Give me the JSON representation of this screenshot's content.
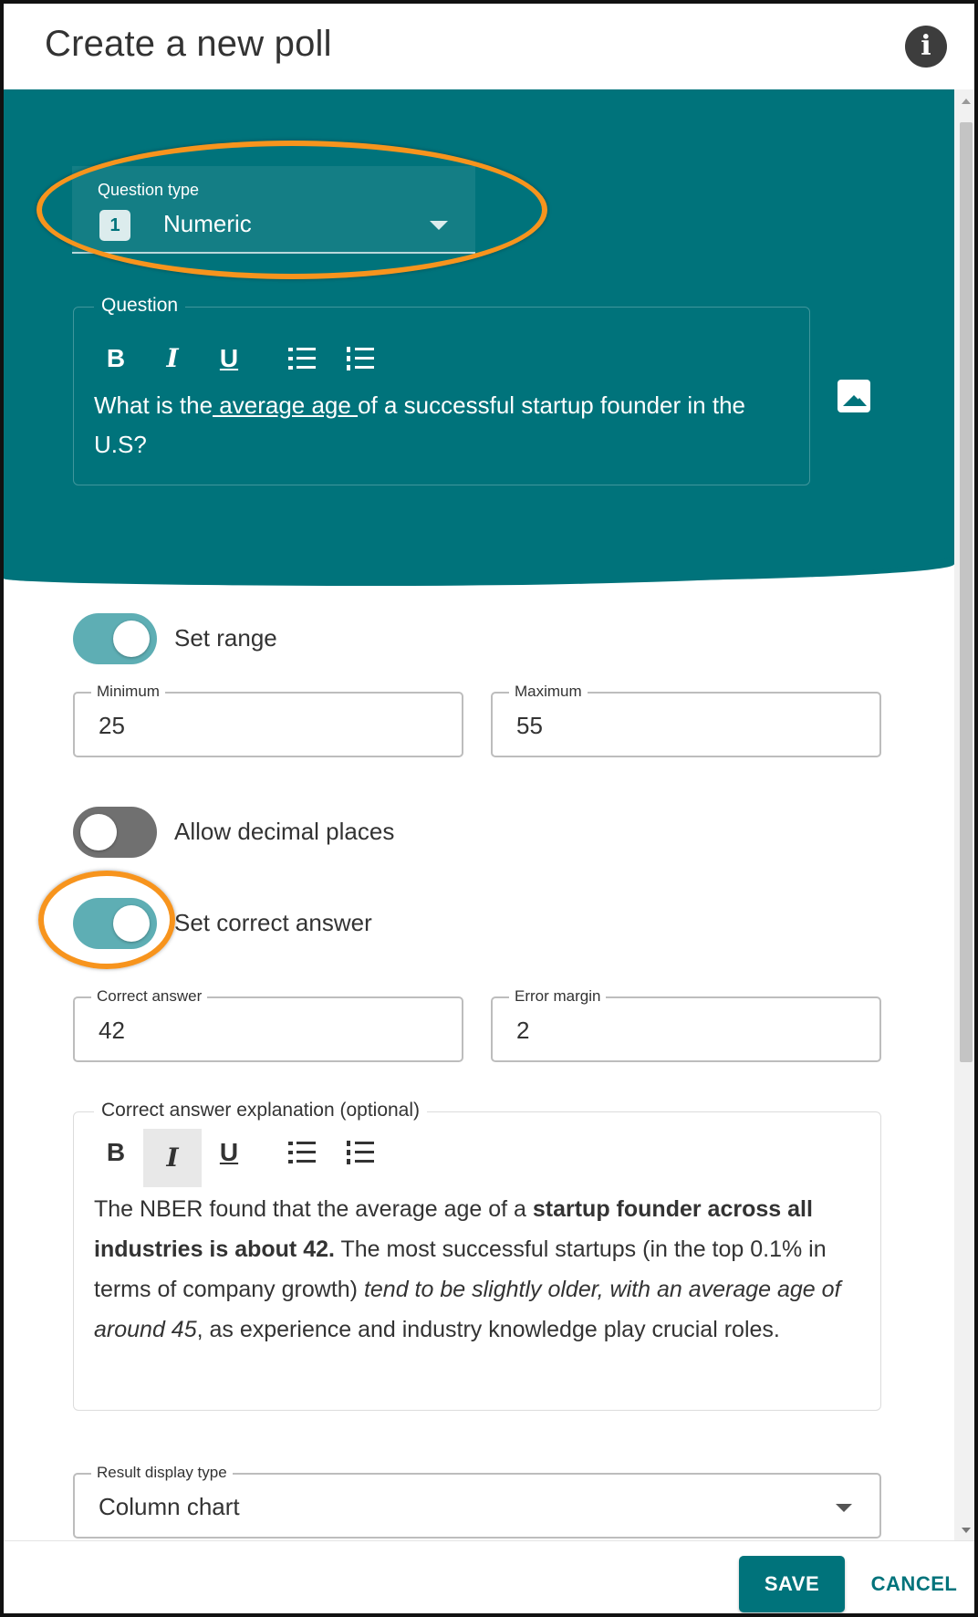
{
  "dialog": {
    "title": "Create a new poll"
  },
  "question_type": {
    "label": "Question type",
    "badge": "1",
    "value": "Numeric"
  },
  "question": {
    "legend": "Question",
    "text_before": "What is the",
    "text_underlined": " average age ",
    "text_after": "of a successful startup founder in the U.S?"
  },
  "toolbar": {
    "bold": "B",
    "italic": "I",
    "underline": "U"
  },
  "set_range": {
    "label": "Set range",
    "on": true
  },
  "range": {
    "min_label": "Minimum",
    "min_value": "25",
    "max_label": "Maximum",
    "max_value": "55"
  },
  "decimal": {
    "label": "Allow decimal places",
    "on": false
  },
  "correct_toggle": {
    "label": "Set correct answer",
    "on": true
  },
  "answer": {
    "correct_label": "Correct answer",
    "correct_value": "42",
    "margin_label": "Error margin",
    "margin_value": "2"
  },
  "explanation": {
    "legend": "Correct answer explanation (optional)",
    "t1": "The NBER found that the average age of a ",
    "t2_bold": "startup founder across all industries is about 42.",
    "t3": " The most successful startups (in the top 0.1% in terms of company growth) ",
    "t4_italic": "tend to be slightly older, with an average age of around 45",
    "t5": ", as experience and industry knowledge play crucial roles."
  },
  "result_display": {
    "label": "Result display type",
    "value": "Column chart"
  },
  "footer": {
    "save": "SAVE",
    "cancel": "CANCEL"
  },
  "colors": {
    "teal": "#00737b",
    "toggle_on": "#5eaeb4",
    "highlight": "#f7941d"
  }
}
